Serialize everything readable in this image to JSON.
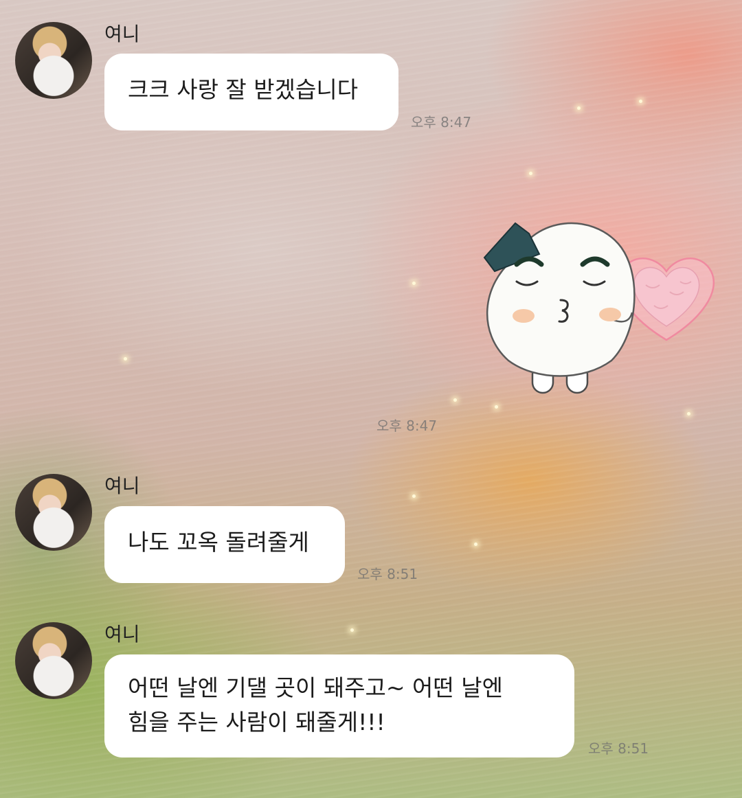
{
  "messages": [
    {
      "sender": "여니",
      "text": "크크 사랑 잘 받겠습니다",
      "time": "오후 8:47"
    },
    {
      "sender": "",
      "sticker": "rice-ball-kiss-heart-sticker",
      "time": "오후 8:47"
    },
    {
      "sender": "여니",
      "text": "나도 꼬옥 돌려줄게",
      "time": "오후 8:51"
    },
    {
      "sender": "여니",
      "text_lines": [
        "어떤 날엔 기댈 곳이 돼주고~ 어떤 날엔",
        "힘을 주는 사람이 돼줄게!!!"
      ],
      "time": "오후 8:51"
    }
  ],
  "colors": {
    "bubble": "#ffffff",
    "text": "#1b1b1b",
    "time": "#8a8a8a"
  }
}
